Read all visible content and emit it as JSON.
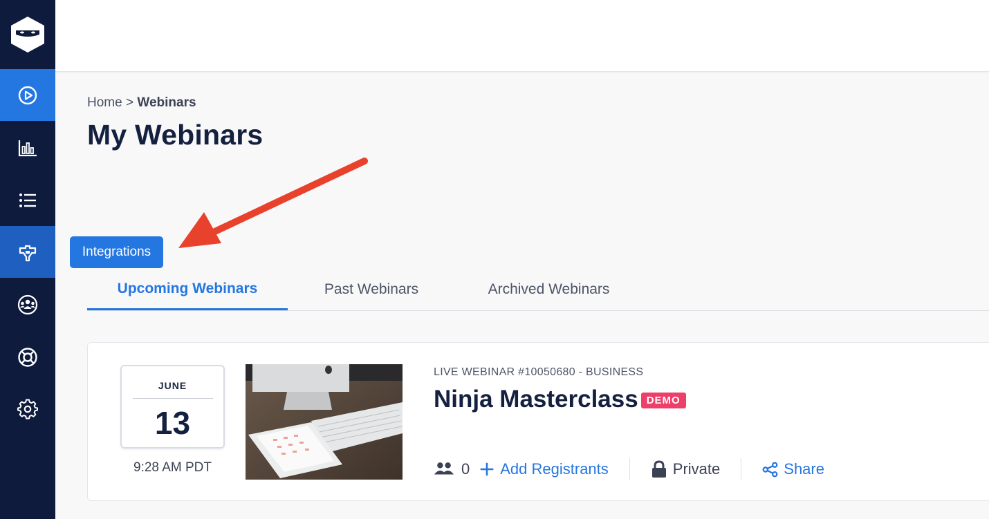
{
  "sidebar": {
    "items": [
      {
        "icon": "play-circle-icon",
        "state": "active"
      },
      {
        "icon": "bar-chart-icon",
        "state": "normal"
      },
      {
        "icon": "list-icon",
        "state": "normal"
      },
      {
        "icon": "integrations-icon",
        "state": "highlight"
      },
      {
        "icon": "users-icon",
        "state": "normal"
      },
      {
        "icon": "lifebuoy-icon",
        "state": "normal"
      },
      {
        "icon": "gear-icon",
        "state": "normal"
      }
    ]
  },
  "breadcrumb": {
    "home": "Home",
    "separator": ">",
    "current": "Webinars"
  },
  "page_title": "My Webinars",
  "integrations_button": "Integrations",
  "tabs": [
    {
      "label": "Upcoming Webinars",
      "active": true
    },
    {
      "label": "Past Webinars",
      "active": false
    },
    {
      "label": "Archived Webinars",
      "active": false
    }
  ],
  "webinar": {
    "date": {
      "month": "JUNE",
      "day": "13",
      "time": "9:28 AM PDT"
    },
    "meta": "LIVE WEBINAR #10050680 - BUSINESS",
    "title": "Ninja Masterclass",
    "badge": "DEMO",
    "registrants_count": "0",
    "add_registrants": "Add Registrants",
    "privacy": "Private",
    "share": "Share"
  },
  "colors": {
    "sidebar": "#0f1b3d",
    "accent": "#2476e0",
    "badge": "#ee3f6a",
    "arrow": "#e8412c"
  }
}
